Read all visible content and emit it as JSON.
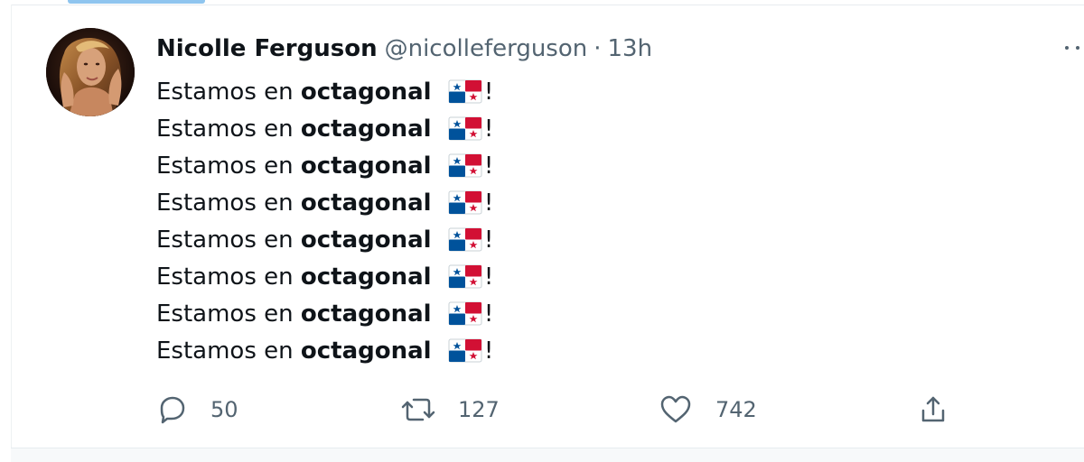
{
  "tweet": {
    "author_name": "Nicolle Ferguson",
    "handle": "@nicolleferguson",
    "separator": "·",
    "time": "13h",
    "line_prefix": "Estamos en ",
    "line_bold": "octagonal",
    "line_suffix": "!",
    "line_count": 8
  },
  "actions": {
    "reply": {
      "icon": "reply-icon",
      "count": "50"
    },
    "retweet": {
      "icon": "retweet-icon",
      "count": "127"
    },
    "like": {
      "icon": "heart-icon",
      "count": "742"
    },
    "share": {
      "icon": "share-icon"
    }
  },
  "colors": {
    "text": "#0f1419",
    "secondary_text": "#536471",
    "flag_blue": "#00529b",
    "flag_red": "#d21034"
  },
  "icons": {
    "avatar": "avatar-photo",
    "flag": "panama-flag-icon",
    "more": "more-options-icon"
  }
}
